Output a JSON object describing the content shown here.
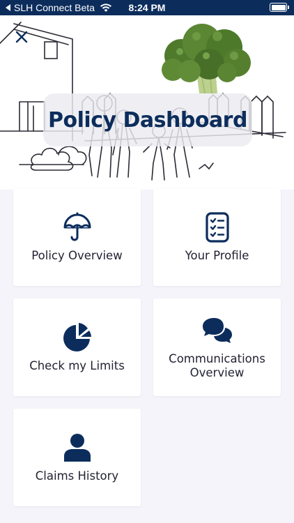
{
  "status_bar": {
    "carrier": "SLH Connect Beta",
    "time": "8:24 PM"
  },
  "header": {
    "title": "Policy Dashboard"
  },
  "tiles": [
    {
      "label": "Policy Overview",
      "icon": "umbrella-icon"
    },
    {
      "label": "Your Profile",
      "icon": "clipboard-checklist-icon"
    },
    {
      "label": "Check my Limits",
      "icon": "pie-chart-icon"
    },
    {
      "label": "Communications Overview",
      "icon": "chat-bubbles-icon"
    },
    {
      "label": "Claims History",
      "icon": "person-icon"
    }
  ],
  "colors": {
    "brand": "#0c2d5c",
    "background": "#f4f4fa",
    "tile": "#ffffff"
  }
}
